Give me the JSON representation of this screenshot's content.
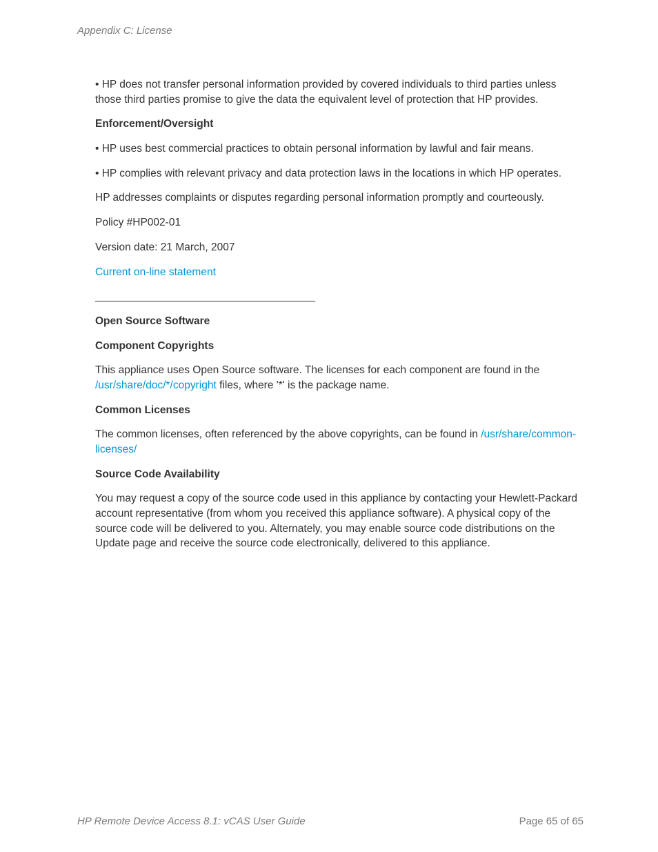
{
  "header": {
    "section": "Appendix C: License"
  },
  "body": {
    "p1": "• HP does not transfer personal information provided by covered individuals to third parties unless those third parties promise to give the data the equivalent level of protection that HP provides.",
    "h1": "Enforcement/Oversight",
    "p2": "• HP uses best commercial practices to obtain personal information by lawful and fair means.",
    "p3": "• HP complies with relevant privacy and data protection laws in the locations in which HP operates.",
    "p4": "HP addresses complaints or disputes regarding personal information promptly and courteously.",
    "p5": "Policy #HP002-01",
    "p6": "Version date: 21 March, 2007",
    "link1": "Current on-line statement",
    "divider": "_____________________________________",
    "h2": "Open Source Software",
    "h3": "Component Copyrights",
    "p7a": "This appliance uses Open Source software. The licenses for each component are found in the ",
    "link2": "/usr/share/doc/*/copyright",
    "p7b": " files, where '*' is the package name.",
    "h4": "Common Licenses",
    "p8a": "The common licenses, often referenced by the above copyrights, can be found in ",
    "link3": "/usr/share/common-licenses/",
    "h5": "Source Code Availability",
    "p9": "You may request a copy of the source code used in this appliance by contacting your Hewlett-Packard account representative (from whom you received this appliance software). A physical copy of the source code will be delivered to you. Alternately, you may enable source code distributions on the Update page and receive the source code electronically, delivered to this appliance."
  },
  "footer": {
    "doc_title": "HP Remote Device Access 8.1: vCAS User Guide",
    "page_info": "Page 65 of 65"
  }
}
